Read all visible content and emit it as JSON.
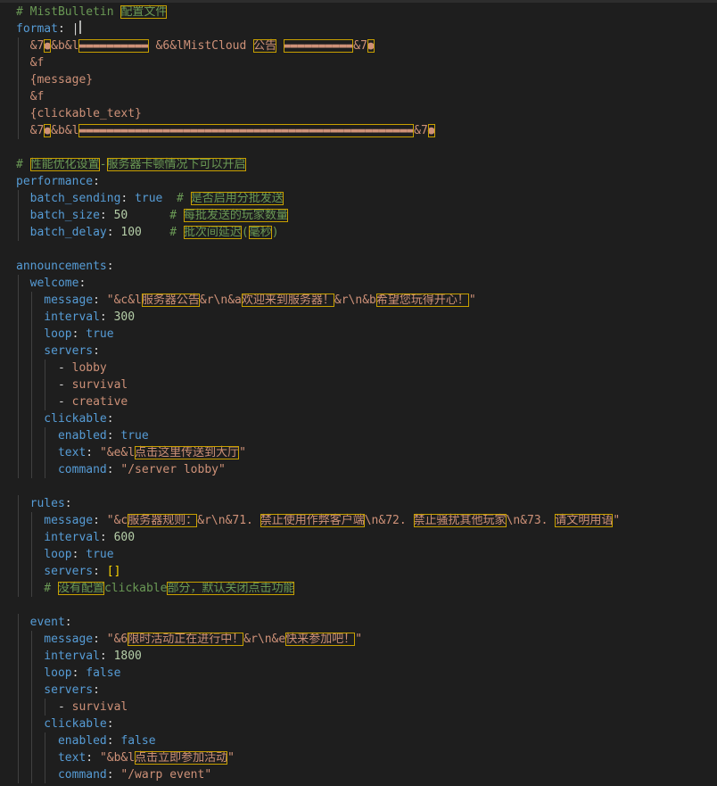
{
  "lines": [
    [
      {
        "t": "# MistBulletin ",
        "c": "c"
      },
      {
        "t": "配置文件",
        "c": "c",
        "box": true
      }
    ],
    [
      {
        "t": "format",
        "c": "k"
      },
      {
        "t": ": |",
        "c": "p"
      },
      {
        "cursor": true
      }
    ],
    [
      {
        "t": "  &7",
        "c": "s"
      },
      {
        "t": "●",
        "c": "s",
        "box": true
      },
      {
        "t": "&b&l",
        "c": "s"
      },
      {
        "t": "▬▬▬▬▬▬▬▬▬▬",
        "c": "s",
        "box": true
      },
      {
        "t": " &6&lMistCloud ",
        "c": "s"
      },
      {
        "t": "公告",
        "c": "s",
        "box": true
      },
      {
        "t": " ",
        "c": "s"
      },
      {
        "t": "▬▬▬▬▬▬▬▬▬▬",
        "c": "s",
        "box": true
      },
      {
        "t": "&7",
        "c": "s"
      },
      {
        "t": "●",
        "c": "s",
        "box": true
      }
    ],
    [
      {
        "t": "  &f",
        "c": "s"
      }
    ],
    [
      {
        "t": "  {message}",
        "c": "s"
      }
    ],
    [
      {
        "t": "  &f",
        "c": "s"
      }
    ],
    [
      {
        "t": "  {clickable_text}",
        "c": "s"
      }
    ],
    [
      {
        "t": "  &7",
        "c": "s"
      },
      {
        "t": "●",
        "c": "s",
        "box": true
      },
      {
        "t": "&b&l",
        "c": "s"
      },
      {
        "t": "▬▬▬▬▬▬▬▬▬▬▬▬▬▬▬▬▬▬▬▬▬▬▬▬▬▬▬▬▬▬▬▬▬▬▬▬▬▬▬▬▬▬▬▬▬▬▬▬",
        "c": "s",
        "box": true
      },
      {
        "t": "&7",
        "c": "s"
      },
      {
        "t": "●",
        "c": "s",
        "box": true
      }
    ],
    [],
    [
      {
        "t": "# ",
        "c": "c"
      },
      {
        "t": "性能优化设置",
        "c": "c",
        "box": true
      },
      {
        "t": "-",
        "c": "c"
      },
      {
        "t": "服务器卡顿情况下可以开启",
        "c": "c",
        "box": true
      }
    ],
    [
      {
        "t": "performance",
        "c": "k"
      },
      {
        "t": ":",
        "c": "p"
      }
    ],
    [
      {
        "t": "  batch_sending",
        "c": "k"
      },
      {
        "t": ": ",
        "c": "p"
      },
      {
        "t": "true",
        "c": "k"
      },
      {
        "t": "  # ",
        "c": "c"
      },
      {
        "t": "是否启用分批发送",
        "c": "c",
        "box": true
      }
    ],
    [
      {
        "t": "  batch_size",
        "c": "k"
      },
      {
        "t": ": ",
        "c": "p"
      },
      {
        "t": "50",
        "c": "n"
      },
      {
        "t": "      # ",
        "c": "c"
      },
      {
        "t": "每批发送的玩家数量",
        "c": "c",
        "box": true
      }
    ],
    [
      {
        "t": "  batch_delay",
        "c": "k"
      },
      {
        "t": ": ",
        "c": "p"
      },
      {
        "t": "100",
        "c": "n"
      },
      {
        "t": "    # ",
        "c": "c"
      },
      {
        "t": "批次间延迟",
        "c": "c",
        "box": true
      },
      {
        "t": "(",
        "c": "c"
      },
      {
        "t": "毫秒",
        "c": "c",
        "box": true
      },
      {
        "t": ")",
        "c": "c"
      }
    ],
    [],
    [
      {
        "t": "announcements",
        "c": "k"
      },
      {
        "t": ":",
        "c": "p"
      }
    ],
    [
      {
        "t": "  welcome",
        "c": "k"
      },
      {
        "t": ":",
        "c": "p"
      }
    ],
    [
      {
        "t": "    message",
        "c": "k"
      },
      {
        "t": ": ",
        "c": "p"
      },
      {
        "t": "\"&c&l",
        "c": "s"
      },
      {
        "t": "服务器公告",
        "c": "s",
        "box": true
      },
      {
        "t": "&r\\n&a",
        "c": "s"
      },
      {
        "t": "欢迎来到服务器！",
        "c": "s",
        "box": true
      },
      {
        "t": "&r\\n&b",
        "c": "s"
      },
      {
        "t": "希望您玩得开心！",
        "c": "s",
        "box": true
      },
      {
        "t": "\"",
        "c": "s"
      }
    ],
    [
      {
        "t": "    interval",
        "c": "k"
      },
      {
        "t": ": ",
        "c": "p"
      },
      {
        "t": "300",
        "c": "n"
      }
    ],
    [
      {
        "t": "    loop",
        "c": "k"
      },
      {
        "t": ": ",
        "c": "p"
      },
      {
        "t": "true",
        "c": "k"
      }
    ],
    [
      {
        "t": "    servers",
        "c": "k"
      },
      {
        "t": ":",
        "c": "p"
      }
    ],
    [
      {
        "t": "      - ",
        "c": "p"
      },
      {
        "t": "lobby",
        "c": "s"
      }
    ],
    [
      {
        "t": "      - ",
        "c": "p"
      },
      {
        "t": "survival",
        "c": "s"
      }
    ],
    [
      {
        "t": "      - ",
        "c": "p"
      },
      {
        "t": "creative",
        "c": "s"
      }
    ],
    [
      {
        "t": "    clickable",
        "c": "k"
      },
      {
        "t": ":",
        "c": "p"
      }
    ],
    [
      {
        "t": "      enabled",
        "c": "k"
      },
      {
        "t": ": ",
        "c": "p"
      },
      {
        "t": "true",
        "c": "k"
      }
    ],
    [
      {
        "t": "      text",
        "c": "k"
      },
      {
        "t": ": ",
        "c": "p"
      },
      {
        "t": "\"&e&l",
        "c": "s"
      },
      {
        "t": "点击这里传送到大厅",
        "c": "s",
        "box": true
      },
      {
        "t": "\"",
        "c": "s"
      }
    ],
    [
      {
        "t": "      command",
        "c": "k"
      },
      {
        "t": ": ",
        "c": "p"
      },
      {
        "t": "\"/server lobby\"",
        "c": "s"
      }
    ],
    [],
    [
      {
        "t": "  rules",
        "c": "k"
      },
      {
        "t": ":",
        "c": "p"
      }
    ],
    [
      {
        "t": "    message",
        "c": "k"
      },
      {
        "t": ": ",
        "c": "p"
      },
      {
        "t": "\"&c",
        "c": "s"
      },
      {
        "t": "服务器规则：",
        "c": "s",
        "box": true
      },
      {
        "t": "&r\\n&71. ",
        "c": "s"
      },
      {
        "t": "禁止使用作弊客户端",
        "c": "s",
        "box": true
      },
      {
        "t": "\\n&72. ",
        "c": "s"
      },
      {
        "t": "禁止骚扰其他玩家",
        "c": "s",
        "box": true
      },
      {
        "t": "\\n&73. ",
        "c": "s"
      },
      {
        "t": "请文明用语",
        "c": "s",
        "box": true
      },
      {
        "t": "\"",
        "c": "s"
      }
    ],
    [
      {
        "t": "    interval",
        "c": "k"
      },
      {
        "t": ": ",
        "c": "p"
      },
      {
        "t": "600",
        "c": "n"
      }
    ],
    [
      {
        "t": "    loop",
        "c": "k"
      },
      {
        "t": ": ",
        "c": "p"
      },
      {
        "t": "true",
        "c": "k"
      }
    ],
    [
      {
        "t": "    servers",
        "c": "k"
      },
      {
        "t": ": ",
        "c": "p"
      },
      {
        "t": "[]",
        "c": "br"
      }
    ],
    [
      {
        "t": "    # ",
        "c": "c"
      },
      {
        "t": "没有配置",
        "c": "c",
        "box": true
      },
      {
        "t": "clickable",
        "c": "c"
      },
      {
        "t": "部分，默认关闭点击功能",
        "c": "c",
        "box": true
      }
    ],
    [],
    [
      {
        "t": "  event",
        "c": "k"
      },
      {
        "t": ":",
        "c": "p"
      }
    ],
    [
      {
        "t": "    message",
        "c": "k"
      },
      {
        "t": ": ",
        "c": "p"
      },
      {
        "t": "\"&6",
        "c": "s"
      },
      {
        "t": "限时活动正在进行中！",
        "c": "s",
        "box": true
      },
      {
        "t": "&r\\n&e",
        "c": "s"
      },
      {
        "t": "快来参加吧！",
        "c": "s",
        "box": true
      },
      {
        "t": "\"",
        "c": "s"
      }
    ],
    [
      {
        "t": "    interval",
        "c": "k"
      },
      {
        "t": ": ",
        "c": "p"
      },
      {
        "t": "1800",
        "c": "n"
      }
    ],
    [
      {
        "t": "    loop",
        "c": "k"
      },
      {
        "t": ": ",
        "c": "p"
      },
      {
        "t": "false",
        "c": "k"
      }
    ],
    [
      {
        "t": "    servers",
        "c": "k"
      },
      {
        "t": ":",
        "c": "p"
      }
    ],
    [
      {
        "t": "      - ",
        "c": "p"
      },
      {
        "t": "survival",
        "c": "s"
      }
    ],
    [
      {
        "t": "    clickable",
        "c": "k"
      },
      {
        "t": ":",
        "c": "p"
      }
    ],
    [
      {
        "t": "      enabled",
        "c": "k"
      },
      {
        "t": ": ",
        "c": "p"
      },
      {
        "t": "false",
        "c": "k"
      }
    ],
    [
      {
        "t": "      text",
        "c": "k"
      },
      {
        "t": ": ",
        "c": "p"
      },
      {
        "t": "\"&b&l",
        "c": "s"
      },
      {
        "t": "点击立即参加活动",
        "c": "s",
        "box": true
      },
      {
        "t": "\"",
        "c": "s"
      }
    ],
    [
      {
        "t": "      command",
        "c": "k"
      },
      {
        "t": ": ",
        "c": "p"
      },
      {
        "t": "\"/warp event\"",
        "c": "s"
      }
    ]
  ]
}
